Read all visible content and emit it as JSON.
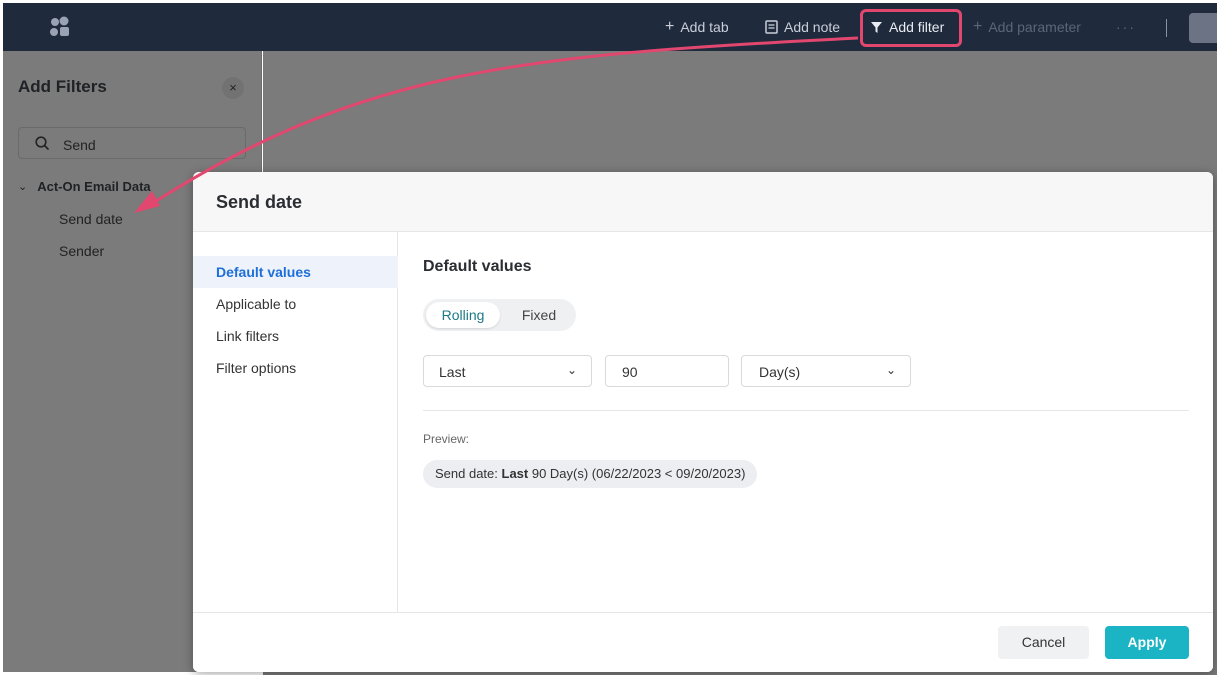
{
  "topbar": {
    "add_tab": "Add tab",
    "add_note": "Add note",
    "add_filter": "Add filter",
    "add_parameter": "Add parameter",
    "more": "···"
  },
  "side_panel": {
    "title": "Add Filters",
    "close": "×",
    "search_value": "Send",
    "group": "Act-On Email Data",
    "items": [
      "Send date",
      "Sender"
    ]
  },
  "modal": {
    "title": "Send date",
    "nav": [
      "Default values",
      "Applicable to",
      "Link filters",
      "Filter options"
    ],
    "content_title": "Default values",
    "segmented": {
      "rolling": "Rolling",
      "fixed": "Fixed",
      "selected": "Rolling"
    },
    "period_select": "Last",
    "amount": "90",
    "unit_select": "Day(s)",
    "preview_label": "Preview:",
    "preview": {
      "prefix": "Send date: ",
      "bold": "Last",
      "suffix": " 90 Day(s) (06/22/2023 < 09/20/2023)"
    },
    "cancel": "Cancel",
    "apply": "Apply"
  },
  "colors": {
    "topbar": "#1f2a3d",
    "accent_link": "#1e6fd9",
    "apply": "#1ab4c4",
    "annotation": "#e2476f"
  }
}
